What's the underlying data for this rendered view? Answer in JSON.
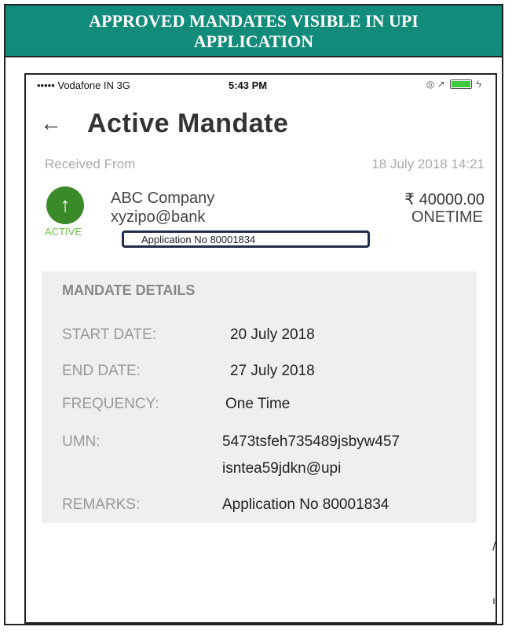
{
  "banner": {
    "line1": "APPROVED MANDATES VISIBLE IN UPI",
    "line2": "APPLICATION"
  },
  "statusbar": {
    "carrier": "••••• Vodafone IN   3G",
    "time": "5:43 PM",
    "icons": "◎ ↗"
  },
  "header": {
    "back_icon": "←",
    "title": "Active Mandate"
  },
  "mandate": {
    "received_label": "Received From",
    "received_date": "18 July 2018 14:21",
    "avatar_icon": "↑",
    "status": "ACTIVE",
    "payee_name": "ABC Company",
    "payee_vpa": "xyzipo@bank",
    "amount": "₹ 40000.00",
    "type": "ONETIME",
    "application_no": "Application No 80001834"
  },
  "details": {
    "heading": "MANDATE DETAILS",
    "start_label": "START DATE:",
    "start_value": "20 July 2018",
    "end_label": "END DATE:",
    "end_value": "27 July 2018",
    "freq_label": "FREQUENCY:",
    "freq_value": "One Time",
    "umn_label": "UMN:",
    "umn_line1": "5473tsfeh735489jsbyw457",
    "umn_line2": "isntea59jdkn@upi",
    "remarks_label": "REMARKS:",
    "remarks_value": "Application No 80001834"
  },
  "colors": {
    "banner": "#128b7a",
    "active_green": "#3b8a2a",
    "status_green": "#6cc04a",
    "battery": "#3ec93e"
  }
}
